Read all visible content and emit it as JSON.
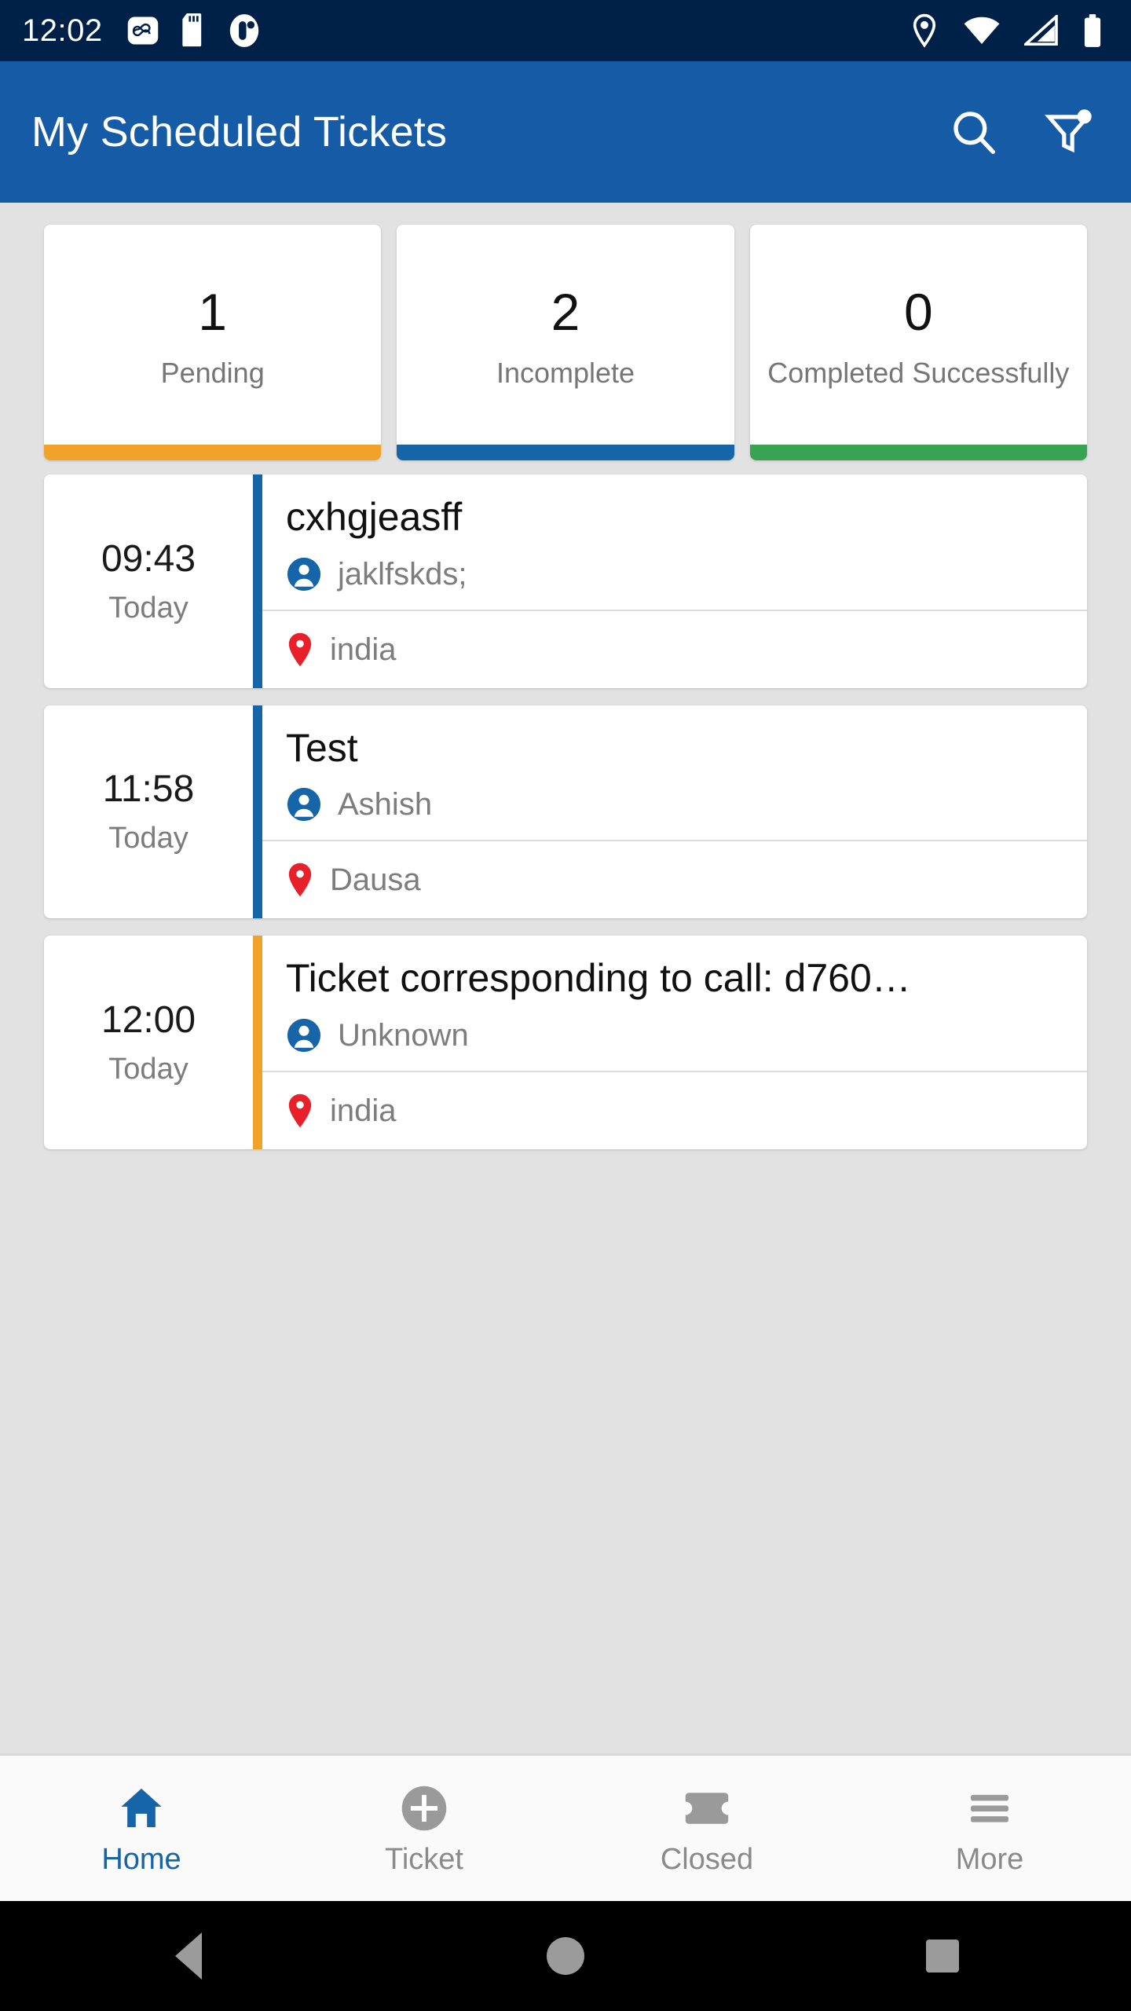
{
  "statusbar": {
    "clock": "12:02",
    "left_icons": [
      "infinity-icon",
      "sd-card-icon",
      "app-badge-icon"
    ],
    "right_icons": [
      "location-icon",
      "wifi-icon",
      "cellular-signal-icon",
      "battery-icon"
    ],
    "background": "#002147"
  },
  "appbar": {
    "title": "My Scheduled Tickets",
    "background": "#155ba5",
    "actions": [
      {
        "name": "search-icon",
        "label": "Search"
      },
      {
        "name": "filter-icon",
        "label": "Filter"
      }
    ]
  },
  "stats": [
    {
      "count": "1",
      "label": "Pending",
      "color": "#f0a22a"
    },
    {
      "count": "2",
      "label": "Incomplete",
      "color": "#1565a8"
    },
    {
      "count": "0",
      "label": "Completed Successfully",
      "color": "#38a353"
    }
  ],
  "tickets": [
    {
      "time": "09:43",
      "day": "Today",
      "title": "cxhgjeasff",
      "person": "jaklfskds;",
      "location": "india",
      "accent": "#1565a8"
    },
    {
      "time": "11:58",
      "day": "Today",
      "title": "Test",
      "person": "Ashish",
      "location": "Dausa",
      "accent": "#1565a8"
    },
    {
      "time": "12:00",
      "day": "Today",
      "title": "Ticket corresponding to call: d760…",
      "person": "Unknown",
      "location": "india",
      "accent": "#f0a22a"
    }
  ],
  "bottomnav": {
    "items": [
      {
        "label": "Home",
        "icon": "home-icon",
        "active": true
      },
      {
        "label": "Ticket",
        "icon": "plus-circle-icon",
        "active": false
      },
      {
        "label": "Closed",
        "icon": "ticket-icon",
        "active": false
      },
      {
        "label": "More",
        "icon": "hamburger-icon",
        "active": false
      }
    ],
    "active_color": "#1565a8",
    "inactive_color": "#9a9a9a"
  },
  "androidnav": {
    "buttons": [
      {
        "label": "Back",
        "icon": "back-triangle-icon"
      },
      {
        "label": "Home",
        "icon": "home-circle-icon"
      },
      {
        "label": "Recents",
        "icon": "recents-square-icon"
      }
    ]
  }
}
